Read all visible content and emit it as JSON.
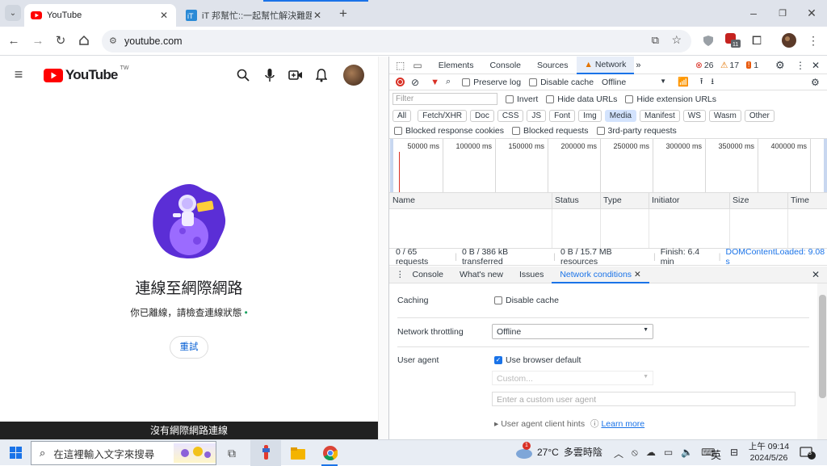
{
  "tabs": [
    {
      "title": "YouTube",
      "close": "✕"
    },
    {
      "title": "iT 邦幫忙::一起幫忙解決難題，拯救 IT 人的一天",
      "close": "✕"
    }
  ],
  "new_tab": "+",
  "address": {
    "url": "youtube.com"
  },
  "page": {
    "logo_text": "YouTube",
    "logo_region": "TW",
    "offline_title": "連線至網際網路",
    "offline_sub": "你已離線，請檢查連線狀態",
    "retry_label": "重試",
    "snackbar": "沒有網際網路連線"
  },
  "devtools": {
    "tabs": [
      "Elements",
      "Console",
      "Sources",
      "Network"
    ],
    "errors": "26",
    "warnings": "17",
    "issues": "1",
    "preserve_log": "Preserve log",
    "disable_cache": "Disable cache",
    "throttle": "Offline",
    "filter_placeholder": "Filter",
    "invert": "Invert",
    "hide_data": "Hide data URLs",
    "hide_ext": "Hide extension URLs",
    "types": [
      "All",
      "Fetch/XHR",
      "Doc",
      "CSS",
      "JS",
      "Font",
      "Img",
      "Media",
      "Manifest",
      "WS",
      "Wasm",
      "Other"
    ],
    "blocked_cookies": "Blocked response cookies",
    "blocked_requests": "Blocked requests",
    "third_party": "3rd-party requests",
    "timeline": [
      "50000 ms",
      "100000 ms",
      "150000 ms",
      "200000 ms",
      "250000 ms",
      "300000 ms",
      "350000 ms",
      "400000 ms"
    ],
    "columns": [
      "Name",
      "Status",
      "Type",
      "Initiator",
      "Size",
      "Time"
    ],
    "status": {
      "requests": "0 / 65 requests",
      "transferred": "0 B / 386 kB transferred",
      "resources": "0 B / 15.7 MB resources",
      "finish": "Finish: 6.4 min",
      "dcl": "DOMContentLoaded: 9.08 s"
    },
    "drawer_tabs": [
      "Console",
      "What's new",
      "Issues",
      "Network conditions"
    ],
    "caching_label": "Caching",
    "caching_opt": "Disable cache",
    "throttling_label": "Network throttling",
    "throttling_value": "Offline",
    "ua_label": "User agent",
    "ua_default": "Use browser default",
    "ua_custom": "Custom...",
    "ua_placeholder": "Enter a custom user agent",
    "ua_hints": "User agent client hints",
    "learn_more": "Learn more"
  },
  "taskbar": {
    "search_placeholder": "在這裡輸入文字來搜尋",
    "temp": "27°C",
    "weather": "多雲時陰",
    "ime": "英",
    "time": "上午 09:14",
    "date": "2024/5/26",
    "notif": "3",
    "weather_badge": "1"
  }
}
